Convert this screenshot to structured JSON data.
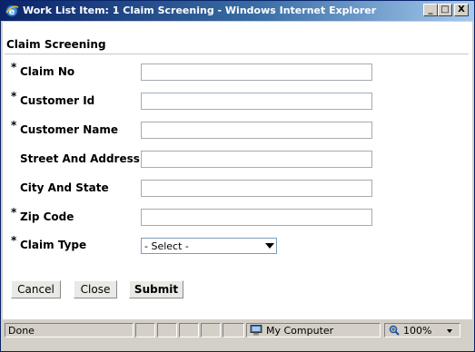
{
  "window": {
    "title": "Work List Item: 1 Claim Screening - Windows Internet Explorer",
    "min_label": "_",
    "max_label": "□",
    "close_label": "X"
  },
  "form": {
    "title": "Claim Screening",
    "required_marker": "*",
    "fields": [
      {
        "label": "Claim No",
        "required": true,
        "value": ""
      },
      {
        "label": "Customer Id",
        "required": true,
        "value": ""
      },
      {
        "label": "Customer Name",
        "required": true,
        "value": ""
      },
      {
        "label": "Street And Address",
        "required": false,
        "value": ""
      },
      {
        "label": "City And State",
        "required": false,
        "value": ""
      },
      {
        "label": "Zip Code",
        "required": true,
        "value": ""
      },
      {
        "label": "Claim Type",
        "required": true,
        "value": "- Select -"
      }
    ]
  },
  "buttons": {
    "cancel": "Cancel",
    "close": "Close",
    "submit": "Submit"
  },
  "statusbar": {
    "status": "Done",
    "zone": "My Computer",
    "zoom": "100%"
  },
  "colors": {
    "title_bar": "#0a246a",
    "chrome": "#d4d0c8"
  }
}
